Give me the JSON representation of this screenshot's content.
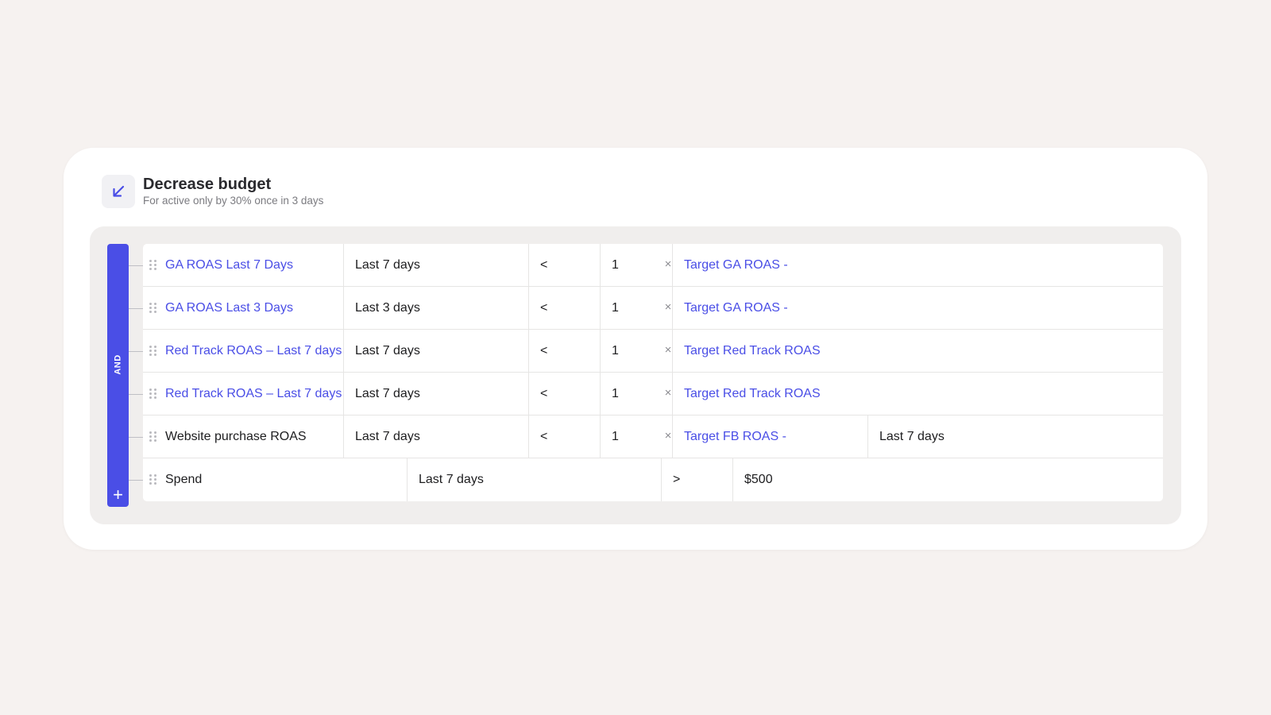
{
  "rule": {
    "title": "Decrease budget",
    "subtitle": "For active only by 30% once in 3 days",
    "icon": "arrow-down-left-icon",
    "accent_color": "#4a4ee6"
  },
  "group": {
    "operator": "AND",
    "add_symbol": "+"
  },
  "conditions": [
    {
      "metric": "GA ROAS Last 7 Days",
      "period": "Last 7 days",
      "op": "<",
      "value": "1",
      "multiply": "×",
      "target": "Target GA ROAS -"
    },
    {
      "metric": "GA ROAS Last 3 Days",
      "period": "Last 3 days",
      "op": "<",
      "value": "1",
      "multiply": "×",
      "target": "Target GA ROAS -"
    },
    {
      "metric": "Red Track ROAS – Last 7 days",
      "period": "Last 7 days",
      "op": "<",
      "value": "1",
      "multiply": "×",
      "target": "Target Red Track ROAS"
    },
    {
      "metric": "Red Track ROAS – Last 7 days",
      "period": "Last 7 days",
      "op": "<",
      "value": "1",
      "multiply": "×",
      "target": "Target Red Track ROAS"
    },
    {
      "metric": "Website purchase ROAS",
      "period": "Last 7 days",
      "op": "<",
      "value": "1",
      "multiply": "×",
      "target": "Target FB ROAS -",
      "target_period": "Last 7 days"
    },
    {
      "metric": "Spend",
      "period": "Last 7 days",
      "op": ">",
      "value": "$500"
    }
  ]
}
